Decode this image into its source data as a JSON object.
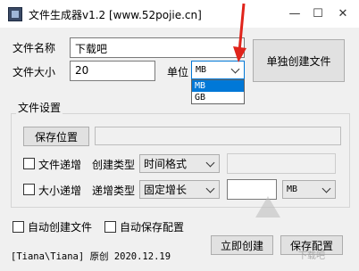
{
  "window": {
    "title": "文件生成器v1.2 [www.52pojie.cn]",
    "minimize": "—",
    "maximize": "☐",
    "close": "✕"
  },
  "form": {
    "filename_label": "文件名称",
    "filename_value": "下载吧",
    "filesize_label": "文件大小",
    "filesize_value": "20",
    "unit_label": "单位",
    "unit_value": "MB",
    "unit_options": [
      "MB",
      "GB"
    ],
    "create_single_button": "单独创建文件"
  },
  "settings": {
    "group_label": "文件设置",
    "save_location_button": "保存位置",
    "save_location_value": "",
    "file_increment_label": "文件递增",
    "create_type_label": "创建类型",
    "create_type_value": "时间格式",
    "size_increment_label": "大小递增",
    "increment_type_label": "递增类型",
    "increment_type_value": "固定增长",
    "increment_unit_value": "MB"
  },
  "options": {
    "auto_create_label": "自动创建文件",
    "auto_save_config_label": "自动保存配置"
  },
  "footer": {
    "credit": "[Tiana\\Tiana] 原创 2020.12.19",
    "create_now_button": "立即创建",
    "save_config_button": "保存配置"
  },
  "watermark": "下载吧",
  "colors": {
    "selection": "#0078d7",
    "annotation_arrow": "#e0241b",
    "highlight_border": "#0078d7"
  }
}
